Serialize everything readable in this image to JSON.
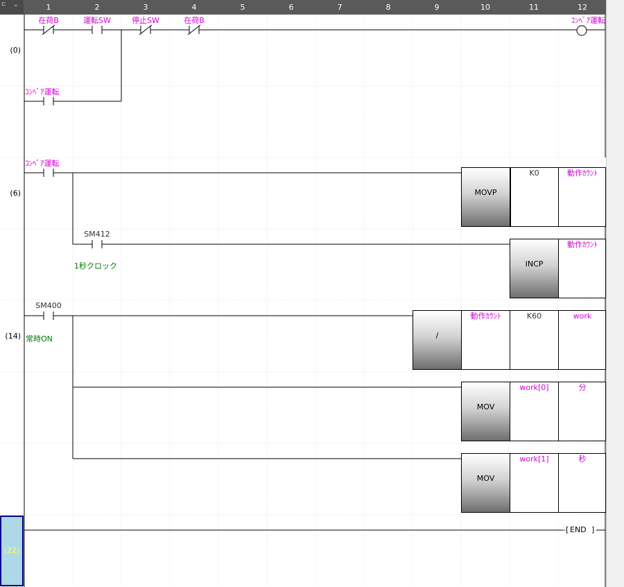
{
  "header": {
    "columns": [
      "1",
      "2",
      "3",
      "4",
      "5",
      "6",
      "7",
      "8",
      "9",
      "10",
      "11",
      "12"
    ]
  },
  "steps": {
    "s0": "(0)",
    "s6": "(6)",
    "s14": "(14)",
    "s22": "(22)"
  },
  "rung0": {
    "c1": "在荷B",
    "c2": "運転SW",
    "c3": "停止SW",
    "c4": "在荷B",
    "coil": "ｺﾝﾍﾞｱ運転",
    "selfhold": "ｺﾝﾍﾞｱ運転"
  },
  "rung6": {
    "contact": "ｺﾝﾍﾞｱ運転",
    "movp": {
      "name": "MOVP",
      "src": "K0",
      "dst": "動作ｶｳﾝﾄ"
    },
    "clock": {
      "device": "SM412",
      "comment": "1秒クロック"
    },
    "incp": {
      "name": "INCP",
      "dst": "動作ｶｳﾝﾄ"
    }
  },
  "rung14": {
    "contact": {
      "device": "SM400",
      "comment": "常時ON"
    },
    "div": {
      "name": "/",
      "s1": "動作ｶｳﾝﾄ",
      "s2": "K60",
      "d": "work"
    },
    "mov1": {
      "name": "MOV",
      "src": "work[0]",
      "dst": "分"
    },
    "mov2": {
      "name": "MOV",
      "src": "work[1]",
      "dst": "秒"
    }
  },
  "end": {
    "label": "END"
  }
}
